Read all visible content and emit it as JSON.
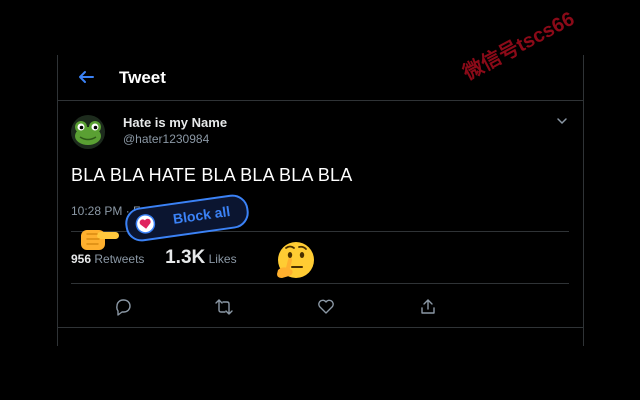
{
  "header": {
    "title": "Tweet",
    "back_icon": "back-arrow-icon"
  },
  "tweet": {
    "display_name": "Hate is my Name",
    "handle": "@hater1230984",
    "avatar_icon": "frog-avatar",
    "text": "BLA BLA HATE BLA BLA BLA BLA",
    "timestamp": "10:28 PM · Feb 25, 20",
    "retweets_count": "956",
    "retweets_label": "Retweets",
    "likes_count": "1.3K",
    "likes_label": "Likes"
  },
  "actions": [
    "reply-icon",
    "retweet-icon",
    "like-icon",
    "share-icon"
  ],
  "overlay": {
    "block_button_label": "Block all",
    "pointing_emoji": "backhand-index-pointing-right",
    "thinking_emoji": "thinking-face"
  },
  "watermark": "微信号tscs66",
  "colors": {
    "background": "#000000",
    "border": "#2f3336",
    "accent": "#3b82f6",
    "muted_text": "#8b98a5",
    "watermark": "#8b0a18"
  }
}
